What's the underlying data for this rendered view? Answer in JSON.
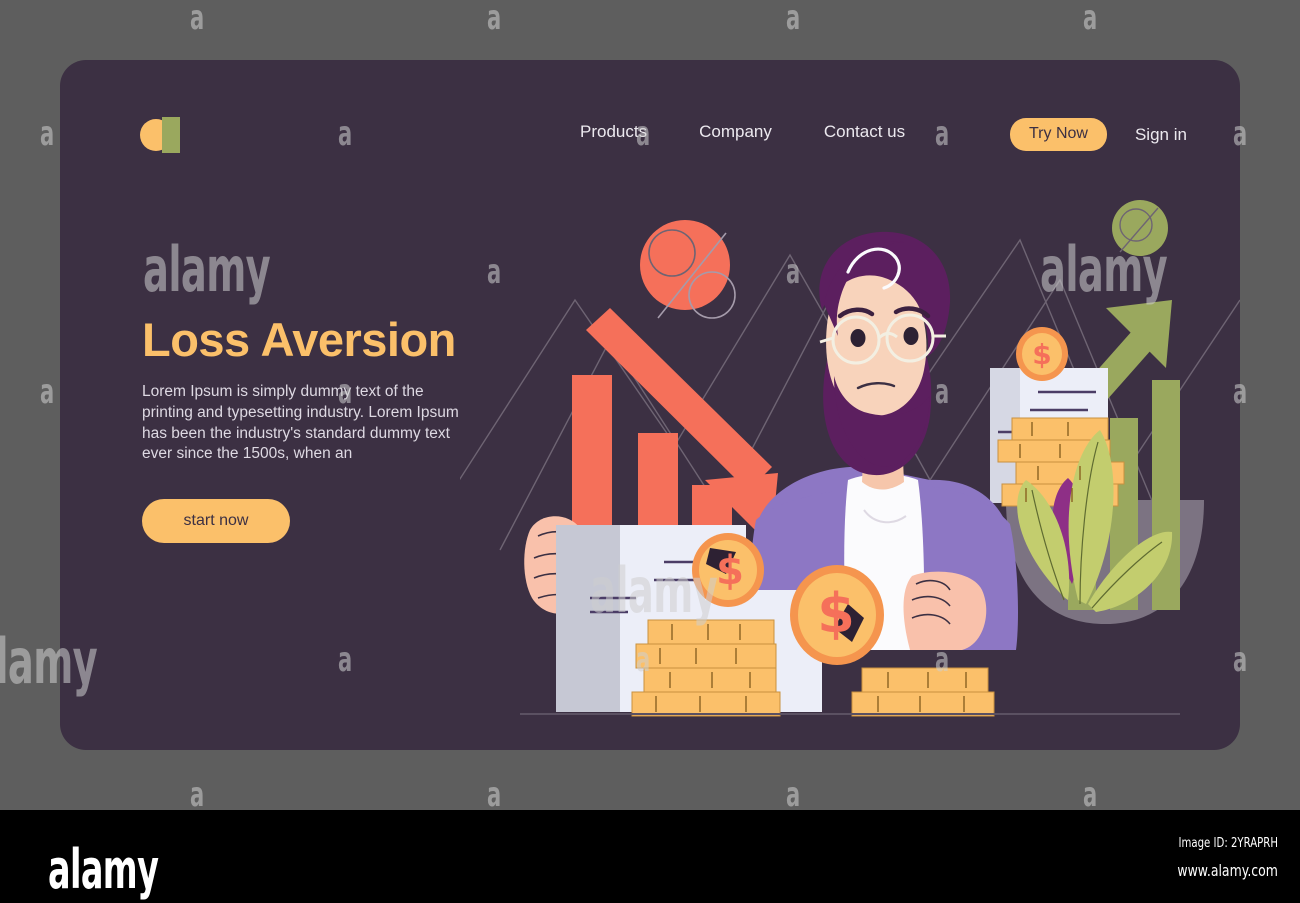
{
  "page": {
    "background_color": "#5e5e5e",
    "card_color": "#3c3043",
    "accent_color": "#fbc06a",
    "loss_color": "#f5705a",
    "gain_color": "#9aa85e"
  },
  "header": {
    "logo": {
      "name": "brand-logo",
      "circle_color": "#fbc06a",
      "rect_color": "#9aa85e"
    },
    "links": [
      {
        "label": "Products"
      },
      {
        "label": "Company"
      },
      {
        "label": "Contact us"
      }
    ],
    "try_now_label": "Try Now",
    "sign_in_label": "Sign in"
  },
  "hero": {
    "title": "Loss Aversion",
    "body": "Lorem Ipsum is simply dummy text of the printing and typesetting industry. Lorem Ipsum has been the industry's standard dummy text ever since the 1500s, when an",
    "cta_label": "start now"
  },
  "illustration": {
    "name": "loss-aversion-illustration",
    "elements": [
      "percent-badge-circle",
      "falling-bar-chart",
      "down-arrow",
      "worried-man-character",
      "dollar-coins",
      "gold-coin-stacks",
      "document-sheets",
      "rising-bar-chart",
      "up-arrow",
      "green-coin-circle",
      "potted-plant"
    ],
    "falling_bars": [
      130,
      88,
      60
    ],
    "rising_bars": [
      58,
      86,
      110
    ]
  },
  "watermark": {
    "mark_small": "a",
    "mark_large": "alamy"
  },
  "footer": {
    "logo": "alamy",
    "image_id": "Image ID: 2YRAPRH",
    "url": "www.alamy.com"
  }
}
